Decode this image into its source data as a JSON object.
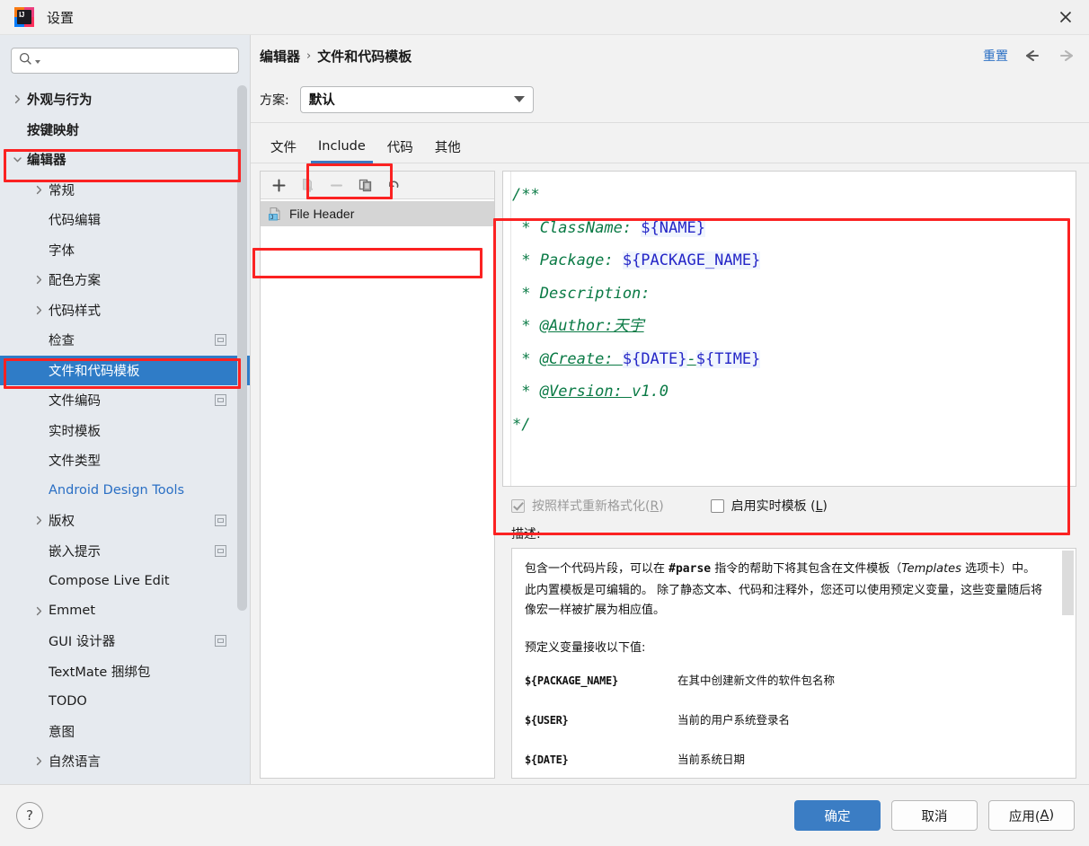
{
  "window": {
    "title": "设置",
    "app_icon": "intellij-idea-icon",
    "close_icon": "close-icon"
  },
  "sidebar": {
    "search": {
      "placeholder": "",
      "value": "",
      "icon": "search-icon"
    },
    "items": [
      {
        "label": "外观与行为",
        "depth": 0,
        "arrow": "collapsed",
        "bold": true
      },
      {
        "label": "按键映射",
        "depth": 0,
        "arrow": "none",
        "bold": true
      },
      {
        "label": "编辑器",
        "depth": 0,
        "arrow": "expanded",
        "bold": true,
        "annotated": true
      },
      {
        "label": "常规",
        "depth": 1,
        "arrow": "collapsed"
      },
      {
        "label": "代码编辑",
        "depth": 1,
        "arrow": "none"
      },
      {
        "label": "字体",
        "depth": 1,
        "arrow": "none"
      },
      {
        "label": "配色方案",
        "depth": 1,
        "arrow": "collapsed"
      },
      {
        "label": "代码样式",
        "depth": 1,
        "arrow": "collapsed"
      },
      {
        "label": "检查",
        "depth": 1,
        "arrow": "none",
        "badge": true
      },
      {
        "label": "文件和代码模板",
        "depth": 1,
        "arrow": "none",
        "selected": true,
        "annotated": true
      },
      {
        "label": "文件编码",
        "depth": 1,
        "arrow": "none",
        "badge": true
      },
      {
        "label": "实时模板",
        "depth": 1,
        "arrow": "none"
      },
      {
        "label": "文件类型",
        "depth": 1,
        "arrow": "none"
      },
      {
        "label": "Android Design Tools",
        "depth": 1,
        "arrow": "none",
        "blue": true
      },
      {
        "label": "版权",
        "depth": 1,
        "arrow": "collapsed",
        "badge": true
      },
      {
        "label": "嵌入提示",
        "depth": 1,
        "arrow": "none",
        "badge": true
      },
      {
        "label": "Compose Live Edit",
        "depth": 1,
        "arrow": "none"
      },
      {
        "label": "Emmet",
        "depth": 1,
        "arrow": "collapsed"
      },
      {
        "label": "GUI 设计器",
        "depth": 1,
        "arrow": "none",
        "badge": true
      },
      {
        "label": "TextMate 捆绑包",
        "depth": 1,
        "arrow": "none"
      },
      {
        "label": "TODO",
        "depth": 1,
        "arrow": "none"
      },
      {
        "label": "意图",
        "depth": 1,
        "arrow": "none"
      },
      {
        "label": "自然语言",
        "depth": 1,
        "arrow": "collapsed"
      }
    ]
  },
  "header": {
    "breadcrumb": [
      "编辑器",
      "文件和代码模板"
    ],
    "separator": "›",
    "reset_label": "重置",
    "back_icon": "arrow-left-icon",
    "forward_icon": "arrow-right-icon"
  },
  "scheme": {
    "label": "方案:",
    "value": "默认",
    "options": [
      "默认"
    ],
    "caret_icon": "chevron-down-icon"
  },
  "tabs": [
    {
      "label": "文件",
      "active": false
    },
    {
      "label": "Include",
      "active": true,
      "annotated": true
    },
    {
      "label": "代码",
      "active": false
    },
    {
      "label": "其他",
      "active": false
    }
  ],
  "list_panel": {
    "toolbar": [
      {
        "name": "add-button",
        "icon": "plus-icon",
        "enabled": true
      },
      {
        "name": "copy-template-button",
        "icon": "copy-file-icon",
        "enabled": false
      },
      {
        "name": "remove-button",
        "icon": "minus-icon",
        "enabled": false
      },
      {
        "name": "duplicate-button",
        "icon": "duplicate-icon",
        "enabled": true
      },
      {
        "name": "revert-button",
        "icon": "undo-icon",
        "enabled": true
      }
    ],
    "items": [
      {
        "label": "File Header",
        "icon": "java-file-icon",
        "selected": true,
        "annotated": true
      }
    ]
  },
  "editor": {
    "annotated": true,
    "lines": [
      [
        {
          "t": "/**",
          "s": "comment"
        }
      ],
      [
        {
          "t": " * ClassName: ",
          "s": "comment"
        },
        {
          "t": "${NAME}",
          "s": "var"
        }
      ],
      [
        {
          "t": " * Package: ",
          "s": "comment"
        },
        {
          "t": "${PACKAGE_NAME}",
          "s": "var"
        }
      ],
      [
        {
          "t": " * Description:",
          "s": "comment"
        }
      ],
      [
        {
          "t": " * ",
          "s": "comment"
        },
        {
          "t": "@Author:天宇",
          "s": "comment-underline"
        }
      ],
      [
        {
          "t": " * ",
          "s": "comment"
        },
        {
          "t": "@Create: ",
          "s": "comment-underline"
        },
        {
          "t": "${DATE}",
          "s": "var"
        },
        {
          "t": "-",
          "s": "comment-underline"
        },
        {
          "t": "${TIME}",
          "s": "var"
        }
      ],
      [
        {
          "t": " * ",
          "s": "comment"
        },
        {
          "t": "@Version: ",
          "s": "comment-underline"
        },
        {
          "t": "v1.0",
          "s": "comment"
        }
      ],
      [
        {
          "t": "*/",
          "s": "comment"
        }
      ]
    ],
    "plain_text": "/**\n * ClassName: ${NAME}\n * Package: ${PACKAGE_NAME}\n * Description:\n * @Author:天宇\n * @Create: ${DATE}-${TIME}\n * @Version: v1.0\n*/"
  },
  "options": {
    "reformat": {
      "label_prefix": "按照样式重新格式化(",
      "mnemonic": "R",
      "label_suffix": ")",
      "checked": true,
      "disabled": true
    },
    "live_template": {
      "label_prefix": "启用实时模板 (",
      "mnemonic": "L",
      "label_suffix": ")",
      "checked": false,
      "disabled": false
    }
  },
  "description": {
    "label": "描述:",
    "paragraph1_a": "包含一个代码片段，可以在 ",
    "paragraph1_code": "#parse",
    "paragraph1_b": " 指令的帮助下将其包含在文件模板（",
    "paragraph1_i": "Templates",
    "paragraph1_c": " 选项卡）中。",
    "paragraph2": "此内置模板是可编辑的。 除了静态文本、代码和注释外，您还可以使用预定义变量，这些变量随后将像宏一样被扩展为相应值。",
    "vars_intro": "预定义变量接收以下值:",
    "vars": [
      {
        "name": "${PACKAGE_NAME}",
        "desc": "在其中创建新文件的软件包名称"
      },
      {
        "name": "${USER}",
        "desc": "当前的用户系统登录名"
      },
      {
        "name": "${DATE}",
        "desc": "当前系统日期"
      }
    ]
  },
  "footer": {
    "help_icon": "question-mark-icon",
    "buttons": [
      {
        "label": "确定",
        "primary": true,
        "mnemonic": ""
      },
      {
        "label": "取消",
        "primary": false,
        "mnemonic": ""
      },
      {
        "label_prefix": "应用(",
        "mnemonic": "A",
        "label_suffix": ")",
        "primary": false
      }
    ]
  },
  "colors": {
    "accent": "#3b7dc4",
    "selection": "#2f7cc7",
    "link": "#2a6fc4",
    "annotation": "#fb2222",
    "comment_green": "#0a7a45",
    "variable_blue": "#2426c7",
    "sidebar_bg": "#e6eaef"
  }
}
